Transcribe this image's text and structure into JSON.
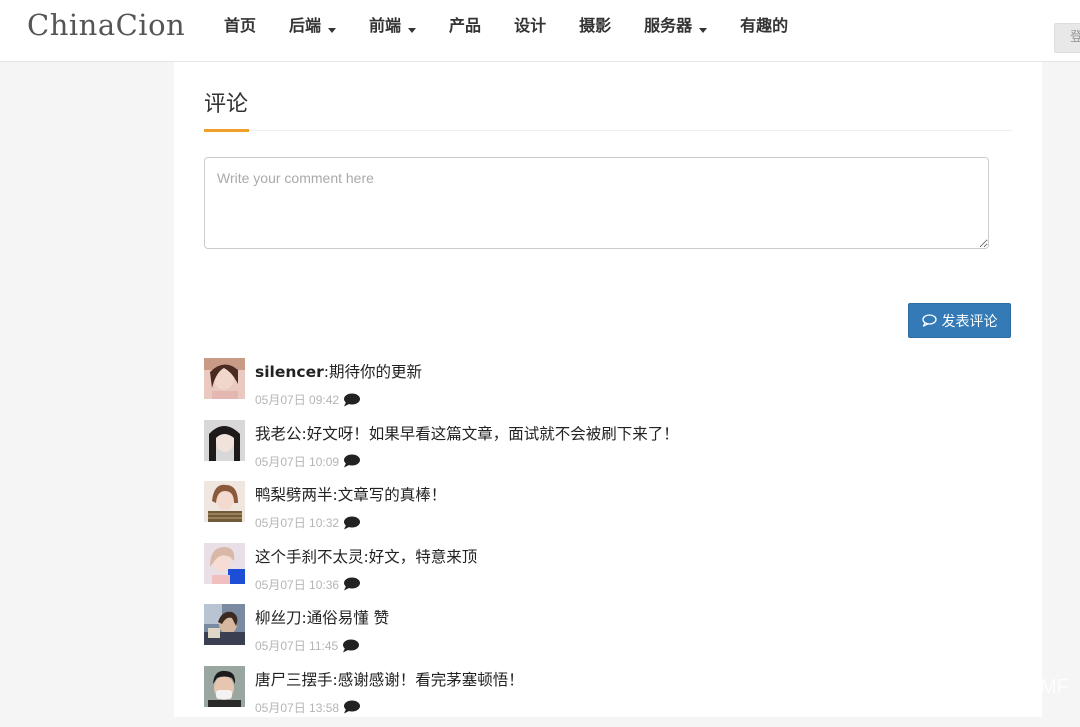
{
  "header": {
    "logo": "ChinaCion",
    "nav": [
      {
        "label": "首页",
        "dropdown": false
      },
      {
        "label": "后端",
        "dropdown": true
      },
      {
        "label": "前端",
        "dropdown": true
      },
      {
        "label": "产品",
        "dropdown": false
      },
      {
        "label": "设计",
        "dropdown": false
      },
      {
        "label": "摄影",
        "dropdown": false
      },
      {
        "label": "服务器",
        "dropdown": true
      },
      {
        "label": "有趣的",
        "dropdown": false
      }
    ],
    "login_label": "登"
  },
  "comments_section": {
    "title": "评论",
    "accent_color": "#f0a02a",
    "input_placeholder": "Write your comment here",
    "input_value": "",
    "submit_label": "发表评论",
    "submit_color": "#337ab7",
    "items": [
      {
        "author": "silencer",
        "text": ":期待你的更新",
        "time": "05月07日 09:42",
        "avatar_icon": "avatar-photo"
      },
      {
        "author": "我老公",
        "text": ":好文呀！如果早看这篇文章，面试就不会被刷下来了！",
        "time": "05月07日 10:09",
        "avatar_icon": "avatar-photo"
      },
      {
        "author": "鸭梨劈两半",
        "text": ":文章写的真棒！",
        "time": "05月07日 10:32",
        "avatar_icon": "avatar-photo"
      },
      {
        "author": "这个手刹不太灵",
        "text": ":好文，特意来顶",
        "time": "05月07日 10:36",
        "avatar_icon": "avatar-photo"
      },
      {
        "author": "柳丝刀",
        "text": ":通俗易懂 赞",
        "time": "05月07日 11:45",
        "avatar_icon": "avatar-photo"
      },
      {
        "author": "唐尸三摆手",
        "text": ":感谢感谢！看完茅塞顿悟！",
        "time": "05月07日 13:58",
        "avatar_icon": "avatar-photo"
      }
    ]
  },
  "watermark": "MF"
}
